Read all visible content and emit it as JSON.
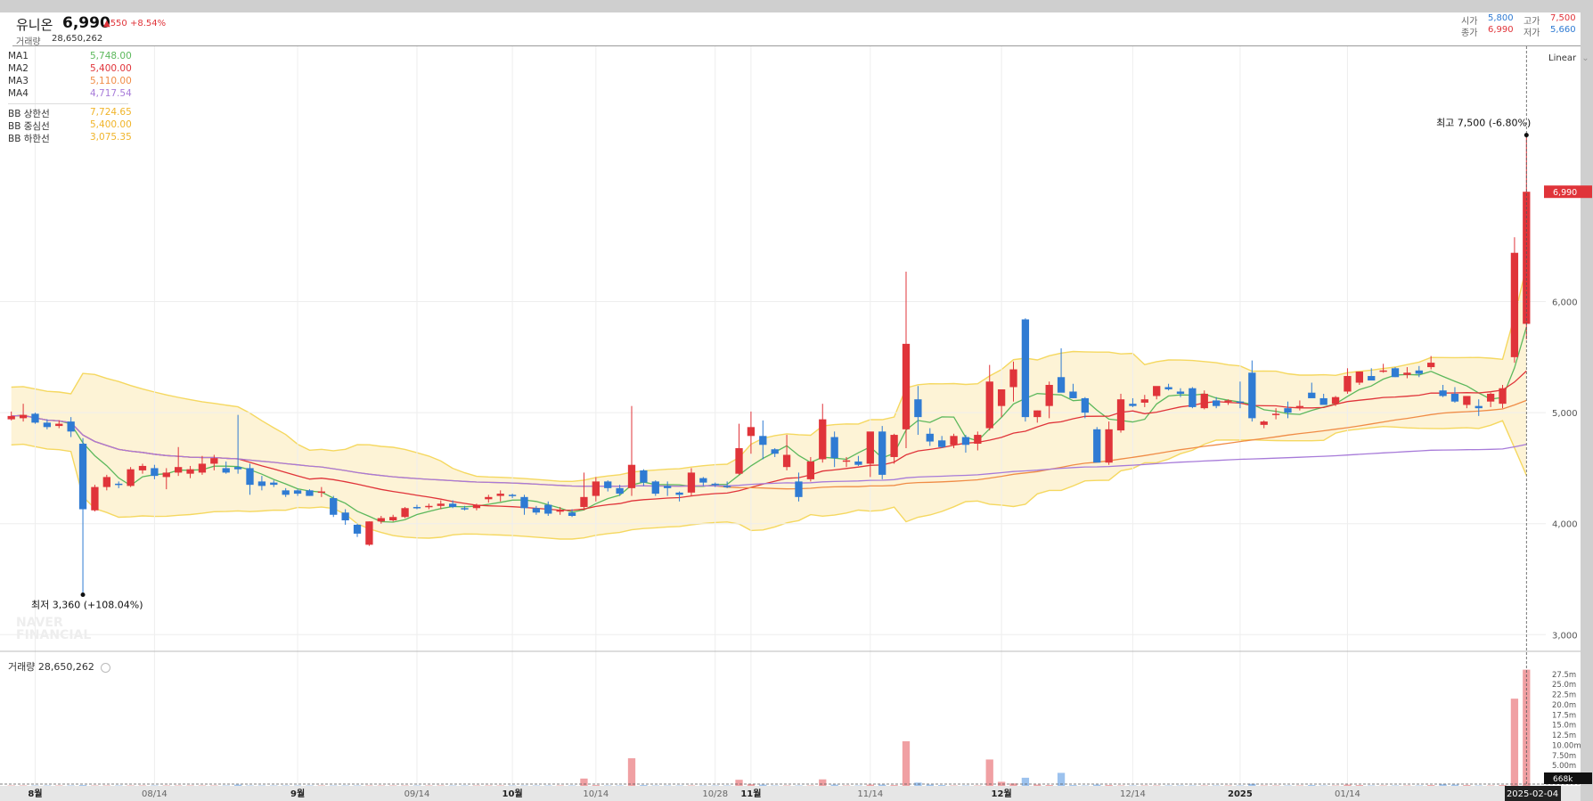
{
  "header": {
    "name": "유니온",
    "price": "6,990",
    "change": "▲550 +8.54%",
    "volume_label": "거래량",
    "volume": "28,650,262",
    "ohlc": [
      {
        "label": "시가",
        "value": "5,800",
        "color": "#2f7bd3"
      },
      {
        "label": "고가",
        "value": "7,500",
        "color": "#e0343a"
      },
      {
        "label": "종가",
        "value": "6,990",
        "color": "#e0343a"
      },
      {
        "label": "저가",
        "value": "5,660",
        "color": "#2f7bd3"
      }
    ]
  },
  "legend": {
    "ma": [
      {
        "label": "MA1",
        "value": "5,748.00",
        "color": "#5cb85c"
      },
      {
        "label": "MA2",
        "value": "5,400.00",
        "color": "#e0343a"
      },
      {
        "label": "MA3",
        "value": "5,110.00",
        "color": "#f08c46"
      },
      {
        "label": "MA4",
        "value": "4,717.54",
        "color": "#a77bd9"
      }
    ],
    "bb": [
      {
        "label": "BB 상한선",
        "value": "7,724.65",
        "color": "#f0b429"
      },
      {
        "label": "BB 중심선",
        "value": "5,400.00",
        "color": "#f0b429"
      },
      {
        "label": "BB 하한선",
        "value": "3,075.35",
        "color": "#f0b429"
      }
    ]
  },
  "scale_mode": "Linear",
  "volume_panel_label": "거래량 28,650,262",
  "watermark": "NAVER FINANCIAL",
  "annotations": {
    "high": "최고 7,500 (-6.80%)",
    "low": "최저 3,360 (+108.04%)",
    "current_price_tag": "6,990",
    "volume_tag": "668k",
    "crosshair_date": "2025-02-04"
  },
  "colors": {
    "up": "#e0343a",
    "down": "#2f7bd3",
    "band_fill": "#fdf3d6",
    "band_line": "#f5d860"
  },
  "chart_data": {
    "type": "candlestick",
    "title": "",
    "xlabel": "",
    "ylabel": "",
    "ylim": [
      2850,
      8300
    ],
    "y_ticks": [
      "3,000",
      "4,000",
      "5,000",
      "6,000"
    ],
    "y_tick_values": [
      3000,
      4000,
      5000,
      6000
    ],
    "x_labels": [
      {
        "label": "8월",
        "bold": true,
        "i": 2
      },
      {
        "label": "08/14",
        "bold": false,
        "i": 12
      },
      {
        "label": "9월",
        "bold": true,
        "i": 24
      },
      {
        "label": "09/14",
        "bold": false,
        "i": 34
      },
      {
        "label": "10월",
        "bold": true,
        "i": 42
      },
      {
        "label": "10/14",
        "bold": false,
        "i": 49
      },
      {
        "label": "10/28",
        "bold": false,
        "i": 59
      },
      {
        "label": "11월",
        "bold": true,
        "i": 62
      },
      {
        "label": "11/14",
        "bold": false,
        "i": 72
      },
      {
        "label": "12월",
        "bold": true,
        "i": 83
      },
      {
        "label": "12/14",
        "bold": false,
        "i": 94
      },
      {
        "label": "2025",
        "bold": true,
        "i": 103
      },
      {
        "label": "01/14",
        "bold": false,
        "i": 112
      }
    ],
    "volume_ticks": [
      "5.00m",
      "7.50m",
      "10.00m",
      "12.5m",
      "15.0m",
      "17.5m",
      "20.0m",
      "22.5m",
      "25.0m",
      "27.5m"
    ],
    "volume_tick_values": [
      5,
      7.5,
      10,
      12.5,
      15,
      17.5,
      20,
      22.5,
      25,
      27.5
    ],
    "volume_ylim": [
      0,
      29
    ],
    "ohlc": [
      [
        4940,
        5010,
        4930,
        4970
      ],
      [
        4950,
        5080,
        4920,
        4980
      ],
      [
        4990,
        5000,
        4900,
        4910
      ],
      [
        4910,
        4940,
        4850,
        4870
      ],
      [
        4880,
        4930,
        4860,
        4900
      ],
      [
        4920,
        4960,
        4780,
        4830
      ],
      [
        4720,
        4770,
        3360,
        4130
      ],
      [
        4120,
        4350,
        4110,
        4330
      ],
      [
        4330,
        4440,
        4300,
        4420
      ],
      [
        4360,
        4380,
        4320,
        4350
      ],
      [
        4340,
        4510,
        4330,
        4490
      ],
      [
        4480,
        4540,
        4450,
        4520
      ],
      [
        4500,
        4530,
        4400,
        4430
      ],
      [
        4420,
        4500,
        4310,
        4460
      ],
      [
        4460,
        4690,
        4430,
        4510
      ],
      [
        4450,
        4520,
        4410,
        4490
      ],
      [
        4460,
        4610,
        4440,
        4540
      ],
      [
        4540,
        4620,
        4480,
        4590
      ],
      [
        4500,
        4560,
        4450,
        4460
      ],
      [
        4510,
        4980,
        4450,
        4490
      ],
      [
        4500,
        4540,
        4260,
        4350
      ],
      [
        4380,
        4430,
        4300,
        4340
      ],
      [
        4370,
        4390,
        4330,
        4350
      ],
      [
        4300,
        4320,
        4240,
        4260
      ],
      [
        4300,
        4310,
        4250,
        4270
      ],
      [
        4300,
        4310,
        4250,
        4250
      ],
      [
        4280,
        4330,
        4240,
        4290
      ],
      [
        4230,
        4250,
        4060,
        4080
      ],
      [
        4100,
        4130,
        3990,
        4030
      ],
      [
        3990,
        4000,
        3880,
        3910
      ],
      [
        3810,
        4020,
        3800,
        4020
      ],
      [
        4020,
        4070,
        4000,
        4050
      ],
      [
        4030,
        4080,
        4020,
        4060
      ],
      [
        4060,
        4150,
        4050,
        4140
      ],
      [
        4150,
        4170,
        4130,
        4140
      ],
      [
        4150,
        4180,
        4130,
        4160
      ],
      [
        4160,
        4210,
        4130,
        4180
      ],
      [
        4180,
        4210,
        4140,
        4150
      ],
      [
        4140,
        4160,
        4120,
        4130
      ],
      [
        4140,
        4180,
        4120,
        4170
      ],
      [
        4220,
        4260,
        4190,
        4240
      ],
      [
        4250,
        4300,
        4200,
        4270
      ],
      [
        4260,
        4270,
        4230,
        4250
      ],
      [
        4240,
        4260,
        4080,
        4140
      ],
      [
        4140,
        4160,
        4080,
        4100
      ],
      [
        4170,
        4200,
        4070,
        4090
      ],
      [
        4110,
        4150,
        4080,
        4120
      ],
      [
        4100,
        4130,
        4060,
        4070
      ],
      [
        4150,
        4460,
        4120,
        4240
      ],
      [
        4250,
        4420,
        4200,
        4380
      ],
      [
        4380,
        4390,
        4290,
        4320
      ],
      [
        4320,
        4350,
        4250,
        4270
      ],
      [
        4320,
        5060,
        4250,
        4530
      ],
      [
        4480,
        4490,
        4340,
        4370
      ],
      [
        4380,
        4390,
        4250,
        4270
      ],
      [
        4340,
        4380,
        4250,
        4320
      ],
      [
        4280,
        4290,
        4200,
        4260
      ],
      [
        4280,
        4500,
        4250,
        4460
      ],
      [
        4410,
        4420,
        4340,
        4370
      ],
      [
        4360,
        4370,
        4330,
        4350
      ],
      [
        4340,
        4380,
        4320,
        4330
      ],
      [
        4450,
        4900,
        4440,
        4680
      ],
      [
        4790,
        5010,
        4630,
        4870
      ],
      [
        4790,
        4930,
        4580,
        4710
      ],
      [
        4670,
        4680,
        4600,
        4630
      ],
      [
        4510,
        4800,
        4480,
        4620
      ],
      [
        4380,
        4460,
        4200,
        4240
      ],
      [
        4400,
        4600,
        4380,
        4560
      ],
      [
        4580,
        5080,
        4550,
        4940
      ],
      [
        4780,
        4830,
        4510,
        4590
      ],
      [
        4570,
        4600,
        4510,
        4570
      ],
      [
        4560,
        4610,
        4520,
        4530
      ],
      [
        4540,
        4800,
        4420,
        4830
      ],
      [
        4830,
        4880,
        4400,
        4440
      ],
      [
        4600,
        4810,
        4540,
        4800
      ],
      [
        4850,
        6270,
        4680,
        5620
      ],
      [
        5120,
        5240,
        4800,
        4960
      ],
      [
        4810,
        4860,
        4700,
        4740
      ],
      [
        4750,
        4790,
        4680,
        4690
      ],
      [
        4710,
        4810,
        4680,
        4790
      ],
      [
        4780,
        4800,
        4640,
        4710
      ],
      [
        4720,
        4830,
        4660,
        4800
      ],
      [
        4860,
        5430,
        4840,
        5280
      ],
      [
        5060,
        5160,
        4960,
        5210
      ],
      [
        5230,
        5460,
        5100,
        5390
      ],
      [
        5840,
        5850,
        4920,
        4960
      ],
      [
        4960,
        5020,
        4910,
        5020
      ],
      [
        5060,
        5280,
        4950,
        5250
      ],
      [
        5320,
        5580,
        5230,
        5180
      ],
      [
        5190,
        5260,
        5130,
        5130
      ],
      [
        5130,
        5140,
        4950,
        5000
      ],
      [
        4850,
        4870,
        4570,
        4550
      ],
      [
        4550,
        4920,
        4530,
        4850
      ],
      [
        4840,
        5170,
        4820,
        5120
      ],
      [
        5080,
        5130,
        5050,
        5060
      ],
      [
        5090,
        5160,
        5050,
        5120
      ],
      [
        5150,
        5230,
        5120,
        5240
      ],
      [
        5230,
        5260,
        5200,
        5210
      ],
      [
        5190,
        5220,
        5140,
        5170
      ],
      [
        5220,
        5230,
        5040,
        5050
      ],
      [
        5040,
        5200,
        5030,
        5170
      ],
      [
        5110,
        5140,
        5040,
        5060
      ],
      [
        5100,
        5120,
        5070,
        5110
      ],
      [
        5100,
        5280,
        5040,
        5090
      ],
      [
        5360,
        5470,
        4920,
        4950
      ],
      [
        4890,
        4930,
        4860,
        4920
      ],
      [
        4980,
        5040,
        4940,
        4990
      ],
      [
        5040,
        5100,
        4950,
        5000
      ],
      [
        5050,
        5110,
        5020,
        5060
      ],
      [
        5180,
        5270,
        5140,
        5130
      ],
      [
        5130,
        5170,
        5090,
        5070
      ],
      [
        5080,
        5150,
        5060,
        5140
      ],
      [
        5190,
        5400,
        5170,
        5330
      ],
      [
        5270,
        5370,
        5250,
        5370
      ],
      [
        5330,
        5400,
        5300,
        5290
      ],
      [
        5380,
        5440,
        5360,
        5380
      ],
      [
        5400,
        5410,
        5320,
        5320
      ],
      [
        5340,
        5410,
        5310,
        5360
      ],
      [
        5380,
        5420,
        5320,
        5350
      ],
      [
        5410,
        5510,
        5390,
        5450
      ],
      [
        5200,
        5250,
        5140,
        5150
      ],
      [
        5170,
        5230,
        5090,
        5100
      ],
      [
        5070,
        5140,
        5040,
        5150
      ],
      [
        5060,
        5120,
        4970,
        5040
      ],
      [
        5100,
        5180,
        5050,
        5170
      ],
      [
        5080,
        5250,
        5040,
        5220
      ],
      [
        5500,
        6580,
        5450,
        6440
      ],
      [
        5800,
        7500,
        5660,
        6990
      ]
    ],
    "volume": [
      0.1,
      0.1,
      0.1,
      0.1,
      0.1,
      0.1,
      0.2,
      0.1,
      0.1,
      0.1,
      0.1,
      0.1,
      0.1,
      0.1,
      0.1,
      0.1,
      0.1,
      0.1,
      0.1,
      0.3,
      0.1,
      0.1,
      0.1,
      0.1,
      0.1,
      0.1,
      0.1,
      0.1,
      0.1,
      0.1,
      0.1,
      0.1,
      0.1,
      0.1,
      0.1,
      0.1,
      0.1,
      0.1,
      0.1,
      0.1,
      0.1,
      0.1,
      0.1,
      0.1,
      0.1,
      0.1,
      0.1,
      0.1,
      1.8,
      0.2,
      0.1,
      0.1,
      6.8,
      0.2,
      0.1,
      0.1,
      0.1,
      0.1,
      0.1,
      0.1,
      0.1,
      1.5,
      0.4,
      0.3,
      0.1,
      0.1,
      0.1,
      0.1,
      1.6,
      0.3,
      0.1,
      0.1,
      0.3,
      0.3,
      0.2,
      11.0,
      0.8,
      0.3,
      0.2,
      0.1,
      0.1,
      0.1,
      6.5,
      1.0,
      0.6,
      2.0,
      0.3,
      0.2,
      3.2,
      0.2,
      0.1,
      0.3,
      0.2,
      0.1,
      0.1,
      0.1,
      0.1,
      0.1,
      0.1,
      0.1,
      0.1,
      0.1,
      0.1,
      0.1,
      0.5,
      0.1,
      0.1,
      0.1,
      0.1,
      0.2,
      0.1,
      0.1,
      0.3,
      0.2,
      0.1,
      0.1,
      0.1,
      0.1,
      0.1,
      0.2,
      0.4,
      0.3,
      0.2,
      0.1,
      0.1,
      0.2,
      21.5,
      28.65
    ]
  }
}
